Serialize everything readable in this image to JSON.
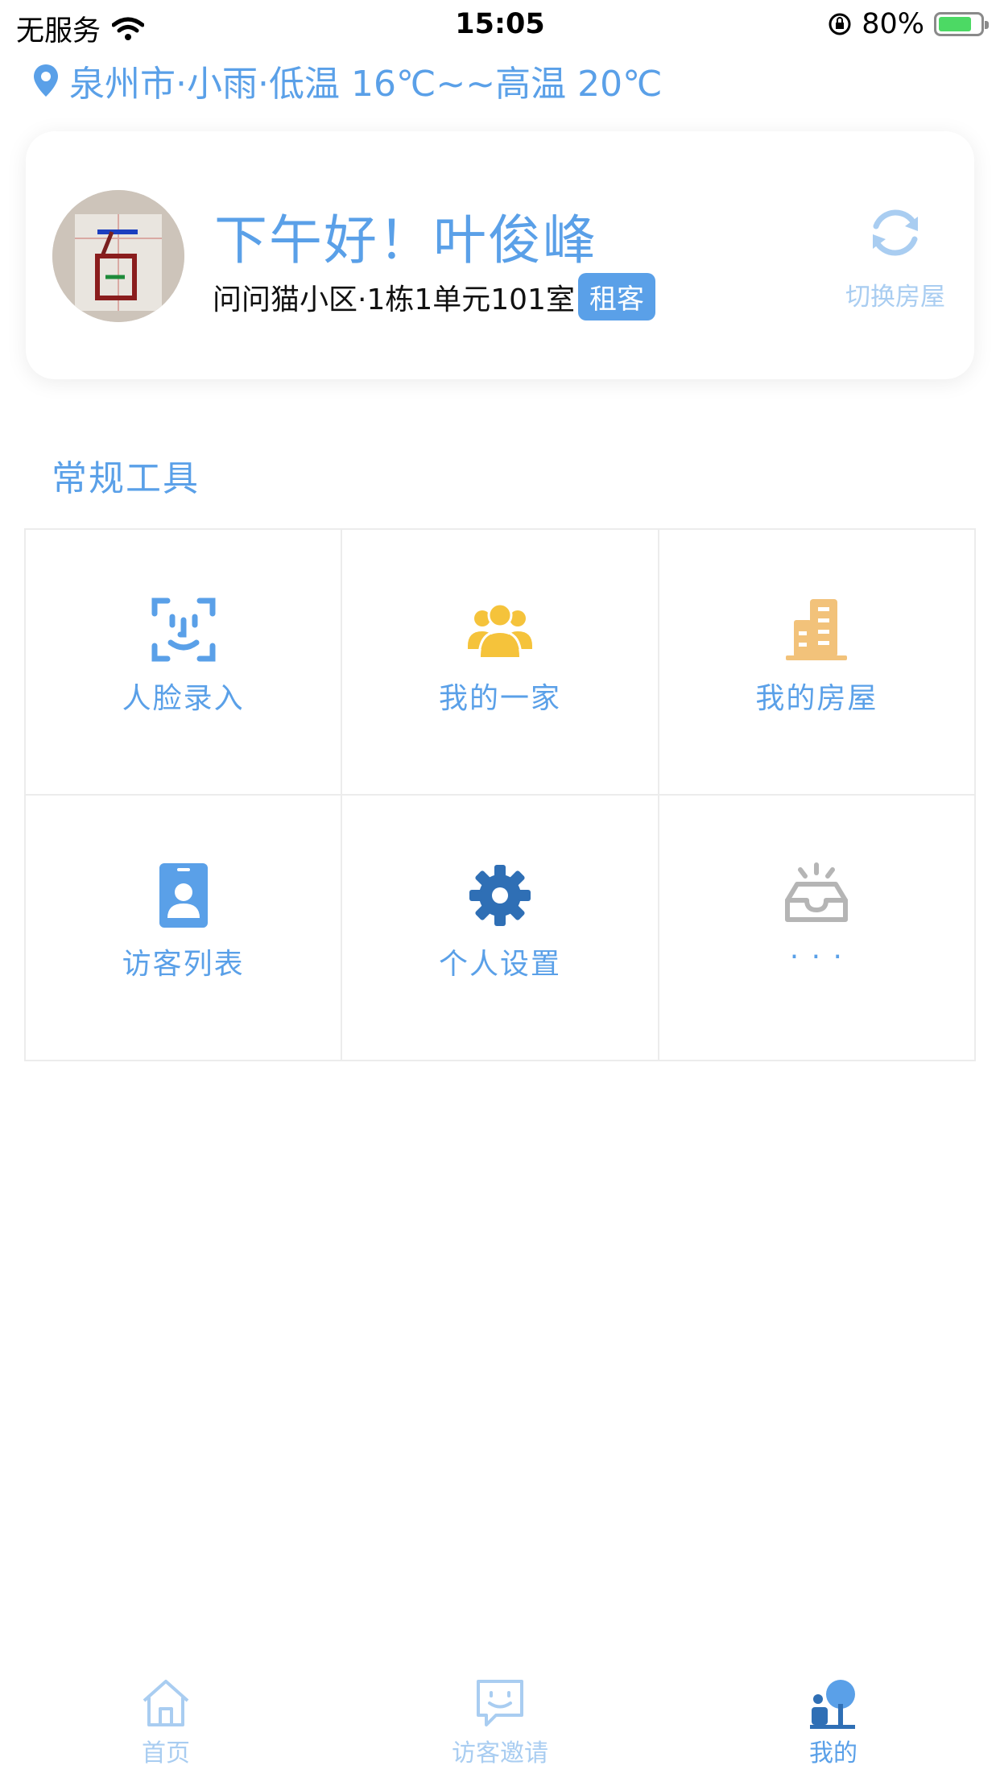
{
  "status_bar": {
    "carrier": "无服务",
    "time": "15:05",
    "battery_percent": "80%",
    "battery_level": 0.8
  },
  "weather": {
    "text": "泉州市·小雨·低温 16℃~~高温 20℃",
    "icon": "location-pin-icon"
  },
  "profile": {
    "greeting": "下午好！叶俊峰",
    "address": "问问猫小区·1栋1单元101室",
    "role": "租客",
    "switch_label": "切换房屋"
  },
  "tools": {
    "title": "常规工具",
    "items": [
      {
        "label": "人脸录入",
        "icon": "face-scan-icon",
        "color": "#5aa0e8"
      },
      {
        "label": "我的一家",
        "icon": "family-icon",
        "color": "#f5c33b"
      },
      {
        "label": "我的房屋",
        "icon": "building-icon",
        "color": "#f2c27a"
      },
      {
        "label": "访客列表",
        "icon": "visitor-card-icon",
        "color": "#5aa0e8"
      },
      {
        "label": "个人设置",
        "icon": "gear-icon",
        "color": "#2f6fb5"
      },
      {
        "label": "· · ·",
        "icon": "inbox-tray-icon",
        "color": "#b5b5b5"
      }
    ]
  },
  "tab_bar": {
    "tabs": [
      {
        "label": "首页",
        "icon": "home-icon",
        "active": false
      },
      {
        "label": "访客邀请",
        "icon": "visitor-invite-icon",
        "active": false
      },
      {
        "label": "我的",
        "icon": "profile-tree-icon",
        "active": true
      }
    ]
  },
  "colors": {
    "accent": "#5aa0e8",
    "inactive": "#a9cdf1",
    "battery_green": "#4cd964"
  }
}
